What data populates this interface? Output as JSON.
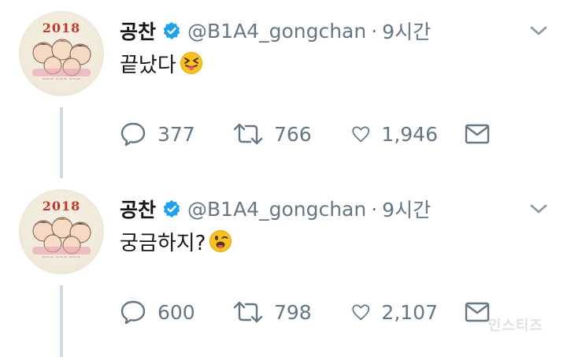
{
  "tweets": [
    {
      "display_name": "공찬",
      "handle": "@B1A4_gongchan",
      "separator": "·",
      "time": "9시간",
      "text": "끝났다",
      "emoji": "squinting-face-with-tongue",
      "reply_count": "377",
      "retweet_count": "766",
      "like_count": "1,946",
      "avatar_year": "2018"
    },
    {
      "display_name": "공찬",
      "handle": "@B1A4_gongchan",
      "separator": "·",
      "time": "9시간",
      "text": "궁금하지?",
      "emoji": "winking-face-with-tongue",
      "reply_count": "600",
      "retweet_count": "798",
      "like_count": "2,107",
      "avatar_year": "2018"
    }
  ],
  "watermark": "인스티즈",
  "colors": {
    "verified_blue": "#1da1f2",
    "secondary_text": "#657786",
    "thread_line": "#cfd9de"
  }
}
